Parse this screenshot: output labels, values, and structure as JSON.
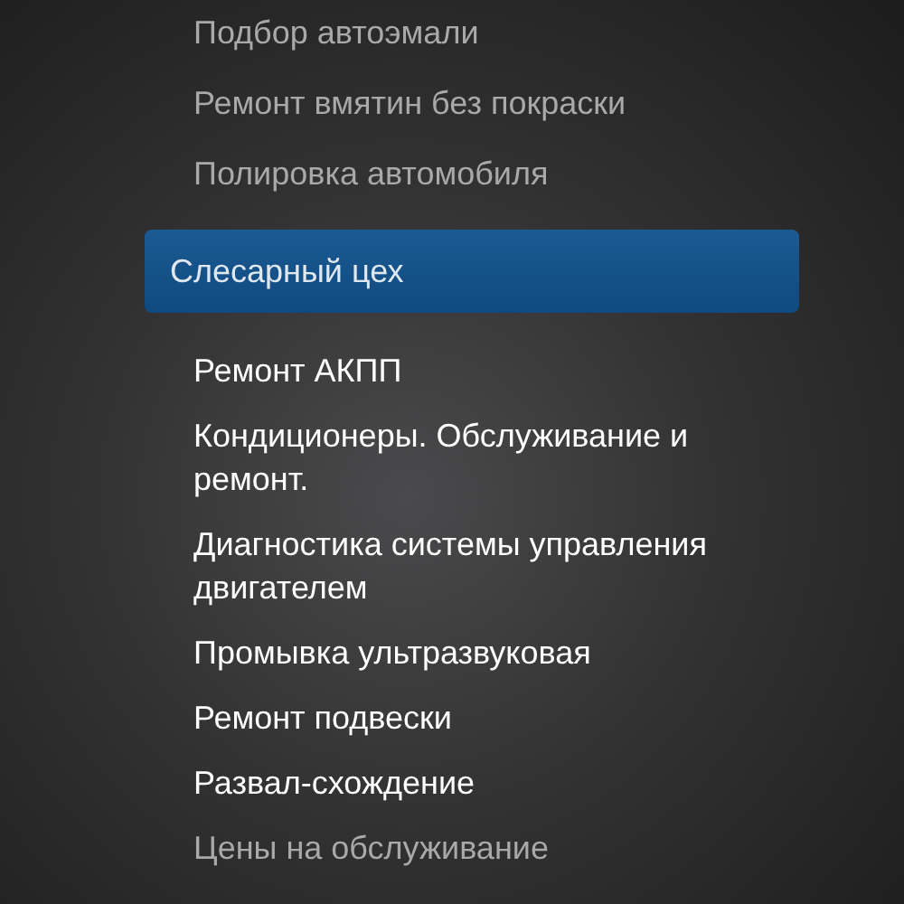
{
  "menu_top": [
    {
      "label": "Подбор автоэмали",
      "muted": true
    },
    {
      "label": "Ремонт вмятин без покраски",
      "muted": true
    },
    {
      "label": "Полировка автомобиля",
      "muted": true
    }
  ],
  "section": {
    "label": "Слесарный цех",
    "selected": true
  },
  "menu_items": [
    {
      "label": "Ремонт АКПП",
      "muted": false
    },
    {
      "label": "Кондиционеры. Обслуживание и ремонт.",
      "muted": false
    },
    {
      "label": "Диагностика системы управления двигателем",
      "muted": false
    },
    {
      "label": "Промывка ультразвуковая",
      "muted": false
    },
    {
      "label": "Ремонт подвески",
      "muted": false
    },
    {
      "label": "Развал-схождение",
      "muted": false
    },
    {
      "label": "Цены на обслуживание",
      "muted": true
    }
  ]
}
